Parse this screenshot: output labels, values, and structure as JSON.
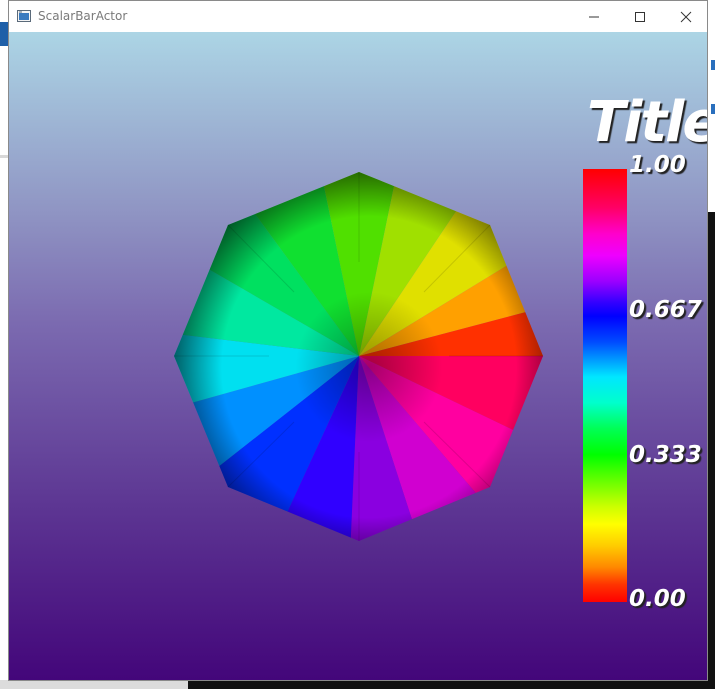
{
  "window": {
    "title": "ScalarBarActor",
    "controls": [
      "minimize",
      "maximize",
      "close"
    ]
  },
  "viewport": {
    "background_top": "#acd5e5",
    "background_bottom": "#43067a",
    "object": "octagon colored by scalar (hue wheel)"
  },
  "scalar_bar": {
    "title": "Title",
    "labels": [
      "1.00",
      "0.667",
      "0.333",
      "0.00"
    ],
    "colors": {
      "max": "#ff0000",
      "magenta": "#ff00ff",
      "blue": "#0000ff",
      "cyan": "#00ffff",
      "green": "#00ff00",
      "yellow": "#ffff00",
      "min": "#ff0000"
    }
  }
}
